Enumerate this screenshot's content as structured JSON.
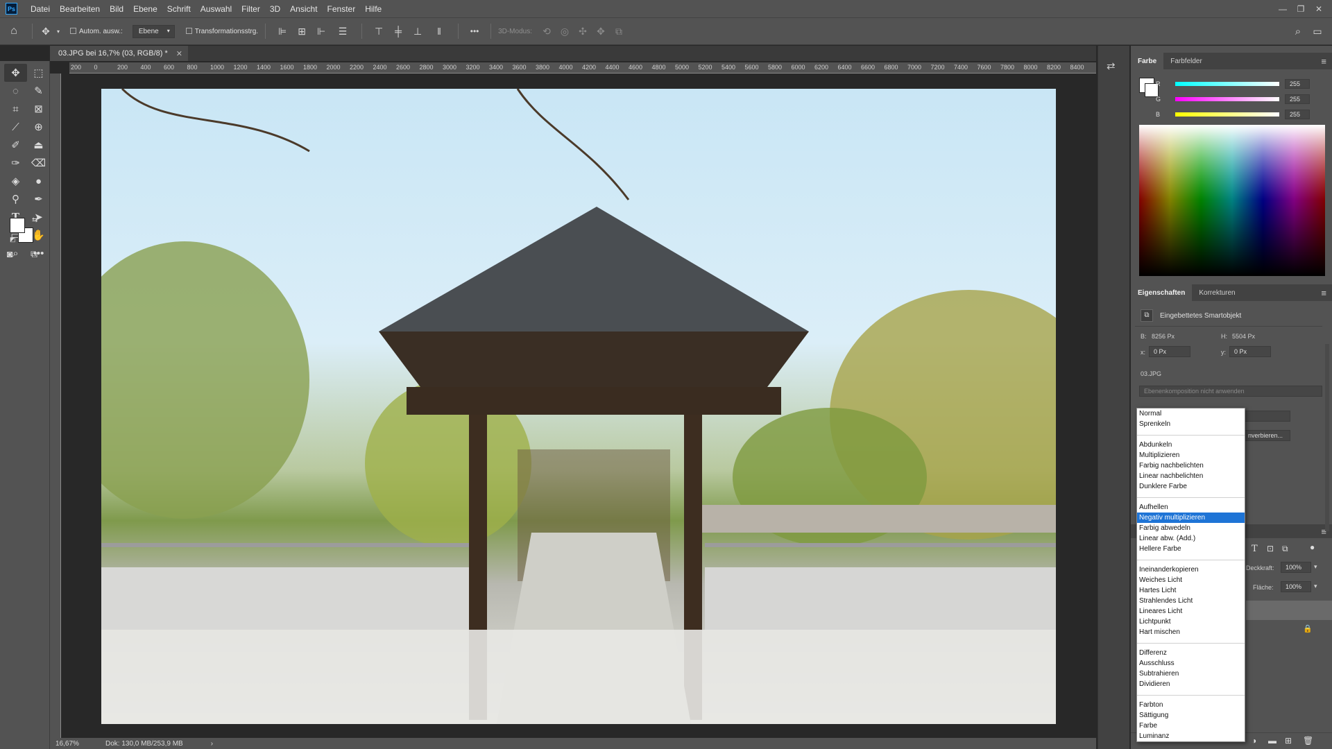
{
  "menubar": {
    "items": [
      "Datei",
      "Bearbeiten",
      "Bild",
      "Ebene",
      "Schrift",
      "Auswahl",
      "Filter",
      "3D",
      "Ansicht",
      "Fenster",
      "Hilfe"
    ],
    "logo": "Ps"
  },
  "optionsbar": {
    "auto_select_label": "Autom. ausw.:",
    "auto_select_target": "Ebene",
    "transform_controls_label": "Transformationsstrg.",
    "three_d_mode_label": "3D-Modus:"
  },
  "document": {
    "tab_title": "03.JPG bei 16,7% (03, RGB/8) *"
  },
  "ruler": {
    "h_ticks": [
      "200",
      "0",
      "200",
      "400",
      "600",
      "800",
      "1000",
      "1200",
      "1400",
      "1600",
      "1800",
      "2000",
      "2200",
      "2400",
      "2600",
      "2800",
      "3000",
      "3200",
      "3400",
      "3600",
      "3800",
      "4000",
      "4200",
      "4400",
      "4600",
      "4800",
      "5000",
      "5200",
      "5400",
      "5600",
      "5800",
      "6000",
      "6200",
      "6400",
      "6600",
      "6800",
      "7000",
      "7200",
      "7400",
      "7600",
      "7800",
      "8000",
      "8200",
      "8400"
    ]
  },
  "statusbar": {
    "zoom": "16,67%",
    "doc_info": "Dok: 130,0 MB/253,9 MB",
    "arrow": "›"
  },
  "color_panel": {
    "tabs": [
      "Farbe",
      "Farbfelder"
    ],
    "channels": [
      {
        "label": "R",
        "value": "255",
        "color": "#00ffff"
      },
      {
        "label": "G",
        "value": "255",
        "color": "#ff00ff"
      },
      {
        "label": "B",
        "value": "255",
        "color": "#ffff00"
      }
    ]
  },
  "properties_panel": {
    "tabs": [
      "Eigenschaften",
      "Korrekturen"
    ],
    "kind": "Eingebettetes Smartobjekt",
    "w_label": "B:",
    "w_value": "8256 Px",
    "h_label": "H:",
    "h_value": "5504 Px",
    "x_label": "x:",
    "x_value": "0 Px",
    "y_label": "y:",
    "y_value": "0 Px",
    "filename": "03.JPG",
    "comp_placeholder": "Ebenenkomposition nicht anwenden",
    "convert_partial": "nverbieren..."
  },
  "layers_panel": {
    "opacity_label": "Deckkraft:",
    "opacity_value": "100%",
    "fill_label": "Fläche:",
    "fill_value": "100%"
  },
  "blend_modes": {
    "groups": [
      [
        "Normal",
        "Sprenkeln"
      ],
      [
        "Abdunkeln",
        "Multiplizieren",
        "Farbig nachbelichten",
        "Linear nachbelichten",
        "Dunklere Farbe"
      ],
      [
        "Aufhellen",
        "Negativ multiplizieren",
        "Farbig abwedeln",
        "Linear abw. (Add.)",
        "Hellere Farbe"
      ],
      [
        "Ineinanderkopieren",
        "Weiches Licht",
        "Hartes Licht",
        "Strahlendes Licht",
        "Lineares Licht",
        "Lichtpunkt",
        "Hart mischen"
      ],
      [
        "Differenz",
        "Ausschluss",
        "Subtrahieren",
        "Dividieren"
      ],
      [
        "Farbton",
        "Sättigung",
        "Farbe",
        "Luminanz"
      ]
    ],
    "selected": "Negativ multiplizieren"
  }
}
